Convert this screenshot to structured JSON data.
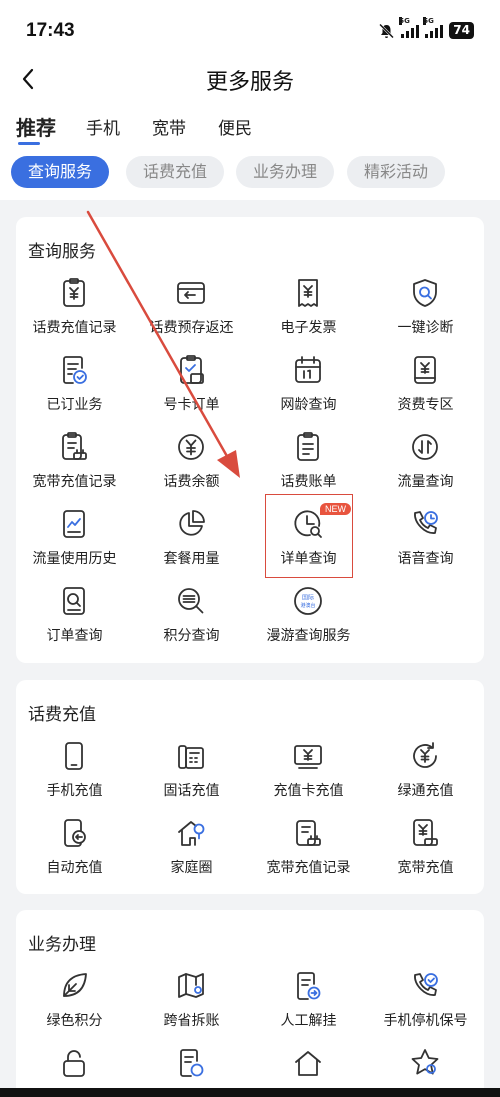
{
  "status_bar": {
    "time": "17:43",
    "signal_label": "5G",
    "battery": "74"
  },
  "header": {
    "title": "更多服务"
  },
  "tabs": [
    {
      "label": "推荐",
      "active": true
    },
    {
      "label": "手机",
      "active": false
    },
    {
      "label": "宽带",
      "active": false
    },
    {
      "label": "便民",
      "active": false
    }
  ],
  "chips": [
    {
      "label": "查询服务",
      "active": true
    },
    {
      "label": "话费充值",
      "active": false
    },
    {
      "label": "业务办理",
      "active": false
    },
    {
      "label": "精彩活动",
      "active": false
    }
  ],
  "sections": [
    {
      "title": "查询服务",
      "items": [
        {
          "label": "话费充值记录",
          "icon": "phone-bill-record-icon"
        },
        {
          "label": "话费预存返还",
          "icon": "prepaid-return-icon"
        },
        {
          "label": "电子发票",
          "icon": "e-invoice-icon"
        },
        {
          "label": "一键诊断",
          "icon": "diagnosis-shield-icon"
        },
        {
          "label": "已订业务",
          "icon": "subscribed-services-icon"
        },
        {
          "label": "号卡订单",
          "icon": "sim-order-icon"
        },
        {
          "label": "网龄查询",
          "icon": "calendar-icon"
        },
        {
          "label": "资费专区",
          "icon": "tariff-icon"
        },
        {
          "label": "宽带充值记录",
          "icon": "broadband-record-icon"
        },
        {
          "label": "话费余额",
          "icon": "balance-icon"
        },
        {
          "label": "话费账单",
          "icon": "bill-icon"
        },
        {
          "label": "流量查询",
          "icon": "data-usage-icon"
        },
        {
          "label": "流量使用历史",
          "icon": "usage-history-icon"
        },
        {
          "label": "套餐用量",
          "icon": "pie-chart-icon"
        },
        {
          "label": "详单查询",
          "icon": "detail-query-icon",
          "badge": "NEW"
        },
        {
          "label": "语音查询",
          "icon": "voice-call-icon"
        },
        {
          "label": "订单查询",
          "icon": "order-search-icon"
        },
        {
          "label": "积分查询",
          "icon": "points-search-icon"
        },
        {
          "label": "漫游查询服务",
          "icon": "roaming-globe-icon",
          "icon_text": [
            "国际",
            "港澳台"
          ]
        }
      ]
    },
    {
      "title": "话费充值",
      "items": [
        {
          "label": "手机充值",
          "icon": "mobile-phone-icon"
        },
        {
          "label": "固话充值",
          "icon": "landline-icon"
        },
        {
          "label": "充值卡充值",
          "icon": "recharge-card-icon"
        },
        {
          "label": "绿通充值",
          "icon": "green-recharge-icon"
        },
        {
          "label": "自动充值",
          "icon": "auto-recharge-icon"
        },
        {
          "label": "家庭圈",
          "icon": "home-circle-icon"
        },
        {
          "label": "宽带充值记录",
          "icon": "broadband-record-icon"
        },
        {
          "label": "宽带充值",
          "icon": "broadband-recharge-icon"
        }
      ]
    },
    {
      "title": "业务办理",
      "items": [
        {
          "label": "绿色积分",
          "icon": "leaf-icon"
        },
        {
          "label": "跨省拆账",
          "icon": "map-icon"
        },
        {
          "label": "人工解挂",
          "icon": "manual-unlock-doc-icon"
        },
        {
          "label": "手机停机保号",
          "icon": "phone-suspend-icon"
        },
        {
          "label": "",
          "icon": "lock-icon"
        },
        {
          "label": "",
          "icon": "doc-transfer-icon"
        },
        {
          "label": "",
          "icon": "home-refresh-icon"
        },
        {
          "label": "",
          "icon": "star-badge-icon"
        }
      ]
    }
  ]
}
